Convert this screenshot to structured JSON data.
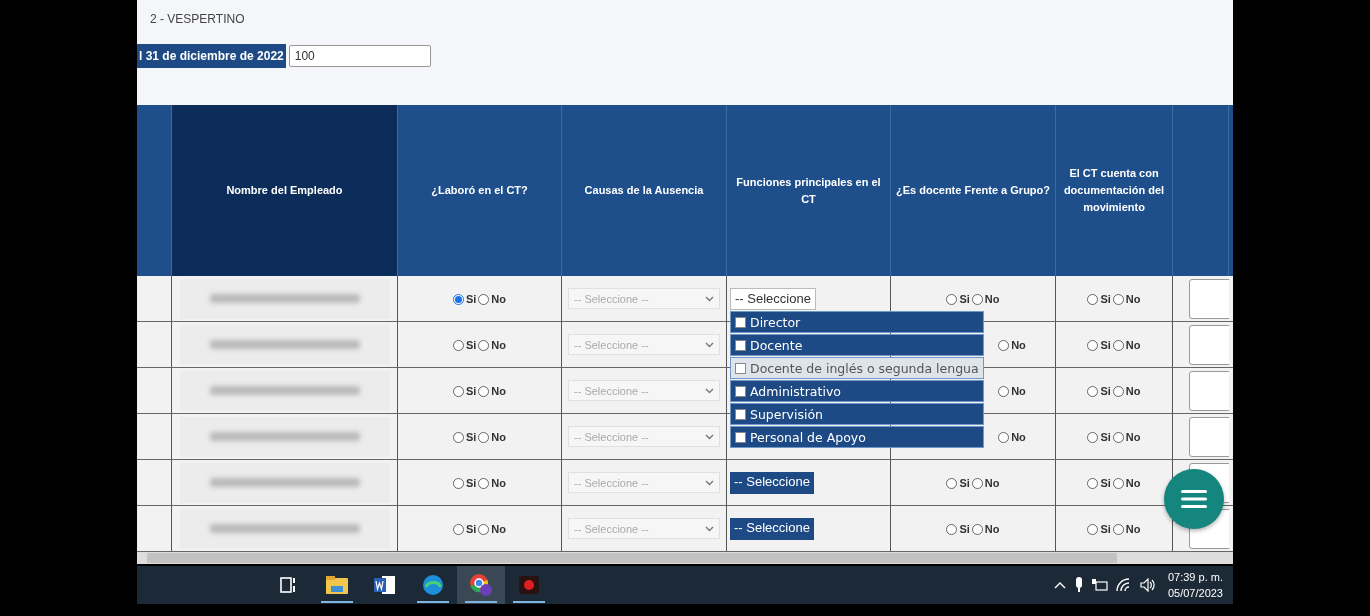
{
  "header": {
    "shift": "2 - VESPERTINO",
    "date_label": "l 31 de diciembre de 2022",
    "date_value": "100"
  },
  "table": {
    "columns": [
      "",
      "Nombre del Empleado",
      "¿Laboró en el CT?",
      "Causas de la Ausencia",
      "Funciones principales en el CT",
      "¿Es docente Frente a Grupo?",
      "El CT cuenta con documentación del movimiento",
      ""
    ],
    "rows": [
      {
        "laboro": [
          {
            "label": "Si",
            "selected": true
          },
          {
            "label": "No",
            "selected": false
          }
        ],
        "causa": "-- Seleccione --",
        "funciones": {
          "value": "-- Seleccione",
          "kind": "open"
        },
        "docente": [
          {
            "label": "Si",
            "selected": false
          },
          {
            "label": "No",
            "selected": false
          }
        ],
        "documentacion": [
          {
            "label": "Si",
            "selected": false
          },
          {
            "label": "No",
            "selected": false
          }
        ]
      },
      {
        "laboro": [
          {
            "label": "Si",
            "selected": false
          },
          {
            "label": "No",
            "selected": false
          }
        ],
        "causa": "-- Seleccione --",
        "docente": [
          {
            "label": "No",
            "selected": false
          }
        ],
        "documentacion": [
          {
            "label": "Si",
            "selected": false
          },
          {
            "label": "No",
            "selected": false
          }
        ]
      },
      {
        "laboro": [
          {
            "label": "Si",
            "selected": false
          },
          {
            "label": "No",
            "selected": false
          }
        ],
        "causa": "-- Seleccione --",
        "docente": [
          {
            "label": "No",
            "selected": false
          }
        ],
        "documentacion": [
          {
            "label": "Si",
            "selected": false
          },
          {
            "label": "No",
            "selected": false
          }
        ]
      },
      {
        "laboro": [
          {
            "label": "Si",
            "selected": false
          },
          {
            "label": "No",
            "selected": false
          }
        ],
        "causa": "-- Seleccione --",
        "docente": [
          {
            "label": "No",
            "selected": false
          }
        ],
        "documentacion": [
          {
            "label": "Si",
            "selected": false
          },
          {
            "label": "No",
            "selected": false
          }
        ]
      },
      {
        "laboro": [
          {
            "label": "Si",
            "selected": false
          },
          {
            "label": "No",
            "selected": false
          }
        ],
        "causa": "-- Seleccione --",
        "funciones": {
          "value": "-- Seleccione",
          "kind": "closed"
        },
        "docente": [
          {
            "label": "Si",
            "selected": false
          },
          {
            "label": "No",
            "selected": false
          }
        ],
        "documentacion": [
          {
            "label": "Si",
            "selected": false
          },
          {
            "label": "No",
            "selected": false
          }
        ]
      },
      {
        "laboro": [
          {
            "label": "Si",
            "selected": false
          },
          {
            "label": "No",
            "selected": false
          }
        ],
        "causa": "-- Seleccione --",
        "funciones": {
          "value": "-- Seleccione",
          "kind": "closed"
        },
        "docente": [
          {
            "label": "Si",
            "selected": false
          },
          {
            "label": "No",
            "selected": false
          }
        ],
        "documentacion": [
          {
            "label": "Si",
            "selected": false
          },
          {
            "label": "No",
            "selected": false
          }
        ]
      }
    ]
  },
  "funciones_dropdown": [
    {
      "label": "Director",
      "checked": false,
      "highlighted": false
    },
    {
      "label": "Docente",
      "checked": false,
      "highlighted": false
    },
    {
      "label": "Docente de inglés o segunda lengua",
      "checked": false,
      "highlighted": true
    },
    {
      "label": "Administrativo",
      "checked": false,
      "highlighted": false
    },
    {
      "label": "Supervisión",
      "checked": false,
      "highlighted": false
    },
    {
      "label": "Personal de Apoyo",
      "checked": false,
      "highlighted": false
    }
  ],
  "taskbar": {
    "apps": [
      {
        "kind": "taskview",
        "running": false,
        "active": false
      },
      {
        "kind": "explorer",
        "running": true,
        "active": false
      },
      {
        "kind": "word",
        "running": false,
        "active": false
      },
      {
        "kind": "edge",
        "running": true,
        "active": false
      },
      {
        "kind": "chrome",
        "running": true,
        "active": true
      },
      {
        "kind": "recorder",
        "running": true,
        "active": false
      }
    ],
    "time": "07:39 p. m.",
    "date": "05/07/2023"
  }
}
